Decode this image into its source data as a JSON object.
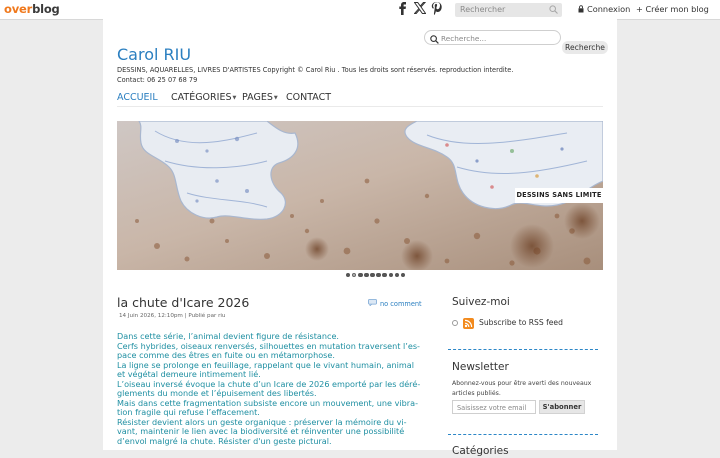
{
  "topbar": {
    "logo_part1": "over",
    "logo_part2": "blog",
    "search_placeholder": "Rechercher",
    "login_label": "Connexion",
    "create_label": "+ Créer mon blog"
  },
  "blog": {
    "title": "Carol RIU",
    "description": "DESSINS, AQUARELLES, LIVRES D'ARTISTES Copyright © Carol Riu . Tous les droits sont réservés. reproduction interdite. Contact: 06 25 07 68 79",
    "search_placeholder": "Recherche...",
    "search_button": "Recherche"
  },
  "nav": [
    {
      "label": "ACCUEIL",
      "active": true
    },
    {
      "label": "CATÉGORIES",
      "has_caret": true
    },
    {
      "label": "PAGES",
      "has_caret": true
    },
    {
      "label": "CONTACT"
    }
  ],
  "slider": {
    "caption": "DESSINS SANS LIMITE",
    "dot_count": 10,
    "active_dot": 1
  },
  "article": {
    "title": "la chute d'Icare 2026",
    "comments": "no comment",
    "meta": "14 Juin 2026, 12:10pm | Publié par riu",
    "paragraphs": [
      "Dans cette série, l’animal devient figure de résistance.",
      "Cerfs hybrides, oiseaux renversés, silhouettes en mutation traversent l’es-pace comme des êtres en fuite ou en métamorphose.",
      "La ligne se prolonge en feuillage, rappelant que le vivant humain, animal et végétal demeure intimement lié.",
      "L’oiseau inversé évoque la chute d’un Icare de 2026 emporté par les déré-glements du monde et l’épuisement des libertés.",
      "Mais dans cette fragmentation subsiste encore un mouvement, une vibra-tion fragile qui refuse l’effacement.",
      "Résister devient alors un geste organique : préserver la mémoire du vi-vant, maintenir le lien avec la biodiversité et réinventer une possibilité d’envol malgré la chute. Résister d'un geste pictural."
    ]
  },
  "sidebar": {
    "follow_title": "Suivez-moi",
    "rss_label": "Subscribe to RSS feed",
    "newsletter_title": "Newsletter",
    "newsletter_text": "Abonnez-vous pour être averti des nouveaux articles publiés.",
    "email_placeholder": "Saisissez votre email",
    "subscribe_button": "S'abonner",
    "categories_title": "Catégories"
  },
  "colors": {
    "accent": "#2b7fc0",
    "article_text": "#1f8fa2",
    "overblog_orange": "#f0791d",
    "rss_orange": "#f28a1d"
  }
}
